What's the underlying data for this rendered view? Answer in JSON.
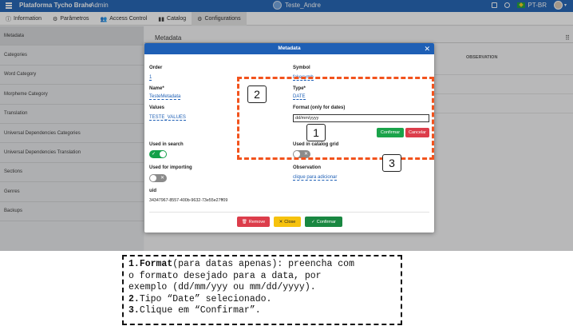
{
  "topbar": {
    "brand": "Plataforma Tycho Brahe",
    "role": "Admin",
    "project": "Teste_Andre",
    "language": "PT-BR"
  },
  "tabs": [
    {
      "label": "Information",
      "icon": "info-icon"
    },
    {
      "label": "Parâmetros",
      "icon": "settings-icon"
    },
    {
      "label": "Access Control",
      "icon": "users-icon"
    },
    {
      "label": "Catalog",
      "icon": "book-icon"
    },
    {
      "label": "Configurations",
      "icon": "gears-icon"
    }
  ],
  "sidebar": {
    "items": [
      {
        "label": "Metadata"
      },
      {
        "label": "Categories"
      },
      {
        "label": "Word Category"
      },
      {
        "label": "Morpheme Category"
      },
      {
        "label": "Translation"
      },
      {
        "label": "Universal Dependencies Categories"
      },
      {
        "label": "Universal Dependencies Translation"
      },
      {
        "label": "Sections"
      },
      {
        "label": "Genres"
      },
      {
        "label": "Backups"
      }
    ]
  },
  "main": {
    "title": "Metadata",
    "observation_header": "OBSERVATION"
  },
  "modal": {
    "title": "Metadata",
    "order_label": "Order",
    "order_value": "1",
    "symbol_label": "Symbol",
    "symbol_value": "fakesymb",
    "name_label": "Name*",
    "name_value": "TesteMetadata",
    "type_label": "Type*",
    "type_value": "DATE",
    "values_label": "Values",
    "values_value": "TESTE_VALUES",
    "format_label": "Format (only for dates)",
    "format_value": "dd/mm/yyyy",
    "confirm_small": "Confirmar",
    "cancel_small": "Cancelar",
    "used_in_search_label": "Used in search",
    "used_in_search": true,
    "used_in_catalog_label": "Used in catalog grid",
    "used_in_catalog": false,
    "used_importing_label": "Used for importing",
    "used_importing": false,
    "observation_label": "Observation",
    "observation_value": "clique para adicionar",
    "uid_label": "uid",
    "uid_value": "34347967-8557-400b-9632-73e55e27ff09",
    "remove_label": "Remove",
    "close_label": "Close",
    "confirm_label": "Confirmar"
  },
  "annotations": {
    "numbers": [
      "1",
      "2",
      "3"
    ],
    "color": "#f2531d"
  },
  "instructions": {
    "line1_num": "1.",
    "line1_bold": "Format",
    "line1_rest": "(para datas apenas): preencha com",
    "line2": "o formato desejado para a data, por",
    "line3": "exemplo (dd/mm/yyy ou mm/dd/yyyy).",
    "line4_num": "2.",
    "line4_rest": "Tipo “Date” selecionado.",
    "line5_num": "3.",
    "line5_rest": "Clique em “Confirmar”."
  }
}
